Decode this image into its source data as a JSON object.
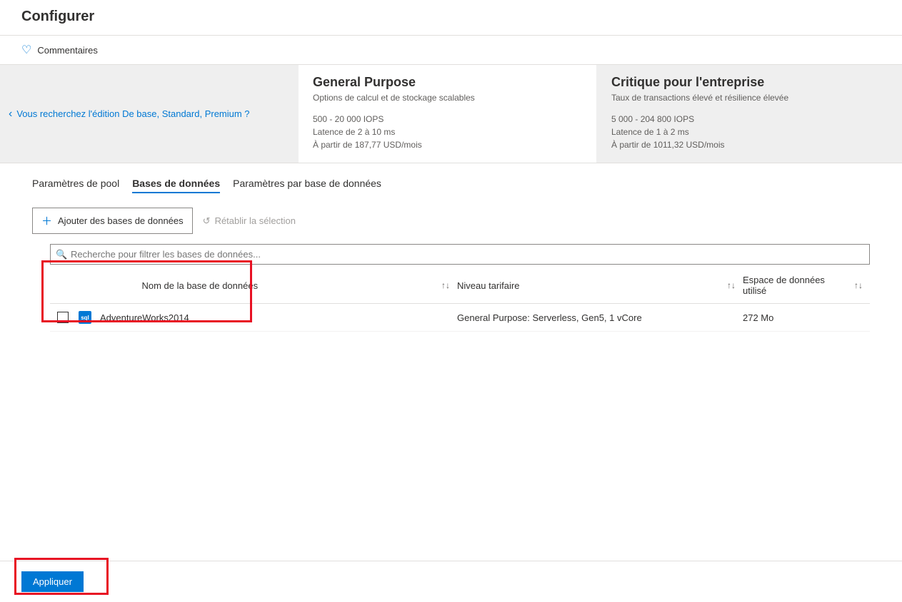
{
  "header": {
    "title": "Configurer"
  },
  "feedback": {
    "label": "Commentaires"
  },
  "tier_nav": {
    "back_link": "Vous recherchez l'édition De base, Standard, Premium ?"
  },
  "tiers": {
    "general": {
      "title": "General Purpose",
      "desc": "Options de calcul et de stockage scalables",
      "iops": "500 - 20 000 IOPS",
      "latency": "Latence de 2 à 10 ms",
      "price": "À partir de 187,77 USD/mois"
    },
    "business": {
      "title": "Critique pour l'entreprise",
      "desc": "Taux de transactions élevé et résilience élevée",
      "iops": "5 000 - 204 800 IOPS",
      "latency": "Latence de 1 à 2 ms",
      "price": "À partir de 1011,32 USD/mois"
    }
  },
  "tabs": {
    "pool": "Paramètres de pool",
    "databases": "Bases de données",
    "perdb": "Paramètres par base de données"
  },
  "toolbar": {
    "add_label": "Ajouter des bases de données",
    "reset_label": "Rétablir la sélection"
  },
  "search": {
    "placeholder": "Recherche pour filtrer les bases de données..."
  },
  "table": {
    "headers": {
      "name": "Nom de la base de données",
      "tier": "Niveau tarifaire",
      "space": "Espace de données utilisé"
    },
    "rows": [
      {
        "name": "AdventureWorks2014",
        "tier": "General Purpose: Serverless, Gen5, 1 vCore",
        "space": "272 Mo"
      }
    ]
  },
  "footer": {
    "apply_label": "Appliquer"
  }
}
